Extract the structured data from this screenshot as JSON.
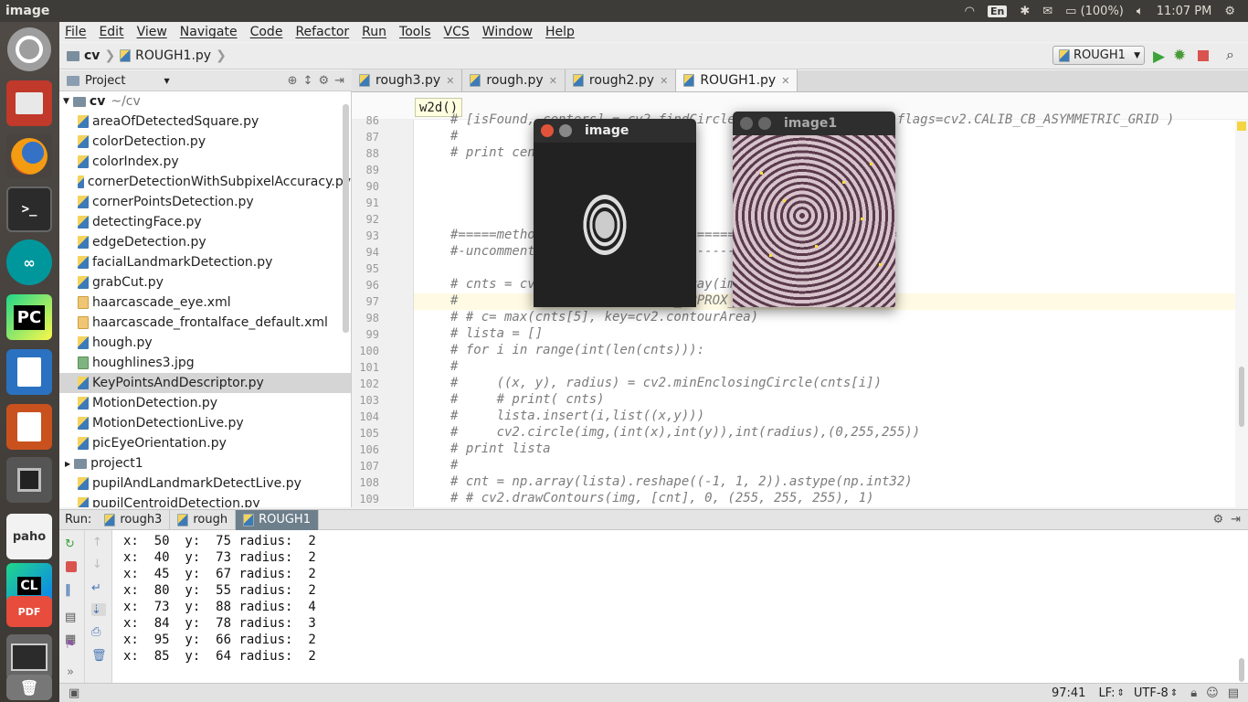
{
  "system": {
    "app_title": "image",
    "keyboard": "En",
    "battery": "(100%)",
    "clock": "11:07 PM"
  },
  "menu": [
    "File",
    "Edit",
    "View",
    "Navigate",
    "Code",
    "Refactor",
    "Run",
    "Tools",
    "VCS",
    "Window",
    "Help"
  ],
  "nav": {
    "project": "cv",
    "file": "ROUGH1.py",
    "run_config": "ROUGH1"
  },
  "project_panel": {
    "title": "Project",
    "root_name": "cv",
    "root_path": "~/cv",
    "files": [
      {
        "name": "areaOfDetectedSquare.py",
        "type": "py"
      },
      {
        "name": "colorDetection.py",
        "type": "py"
      },
      {
        "name": "colorIndex.py",
        "type": "py"
      },
      {
        "name": "cornerDetectionWithSubpixelAccuracy.py",
        "type": "py"
      },
      {
        "name": "cornerPointsDetection.py",
        "type": "py"
      },
      {
        "name": "detectingFace.py",
        "type": "py"
      },
      {
        "name": "edgeDetection.py",
        "type": "py"
      },
      {
        "name": "facialLandmarkDetection.py",
        "type": "py"
      },
      {
        "name": "grabCut.py",
        "type": "py"
      },
      {
        "name": "haarcascade_eye.xml",
        "type": "xml"
      },
      {
        "name": "haarcascade_frontalface_default.xml",
        "type": "xml"
      },
      {
        "name": "hough.py",
        "type": "py"
      },
      {
        "name": "houghlines3.jpg",
        "type": "jpg"
      },
      {
        "name": "KeyPointsAndDescriptor.py",
        "type": "py",
        "selected": true
      },
      {
        "name": "MotionDetection.py",
        "type": "py"
      },
      {
        "name": "MotionDetectionLive.py",
        "type": "py"
      },
      {
        "name": "picEyeOrientation.py",
        "type": "py"
      },
      {
        "name": "project1",
        "type": "folder"
      },
      {
        "name": "pupilAndLandmarkDetectLive.py",
        "type": "py"
      },
      {
        "name": "pupilCentroidDetection.py",
        "type": "py"
      }
    ]
  },
  "tabs": [
    {
      "label": "rough3.py",
      "active": false
    },
    {
      "label": "rough.py",
      "active": false
    },
    {
      "label": "rough2.py",
      "active": false
    },
    {
      "label": "ROUGH1.py",
      "active": true
    }
  ],
  "editor": {
    "breadcrumb": "w2d()",
    "lines": [
      {
        "n": "86",
        "t": "# [isFound, centers] = cv2.findCirclesGrid(image, (4,11), flags=cv2.CALIB_CB_ASYMMETRIC_GRID )"
      },
      {
        "n": "87",
        "t": "#"
      },
      {
        "n": "88",
        "t": "# print centers"
      },
      {
        "n": "89",
        "t": ""
      },
      {
        "n": "90",
        "t": ""
      },
      {
        "n": "91",
        "t": ""
      },
      {
        "n": "92",
        "t": ""
      },
      {
        "n": "93",
        "t": "#=====method 2 ==========================================="
      },
      {
        "n": "94",
        "t": "#-uncomment the below code ---------------"
      },
      {
        "n": "95",
        "t": ""
      },
      {
        "n": "96",
        "t": "# cnts = cv2.findContours(np.array(img), cv2.RETR_CCOMP,"
      },
      {
        "n": "97",
        "t": "#                   cv2.CHAIN_APPROX_NONE)[-2]"
      },
      {
        "n": "98",
        "t": "# # c= max(cnts[5], key=cv2.contourArea)"
      },
      {
        "n": "99",
        "t": "# lista = []"
      },
      {
        "n": "100",
        "t": "# for i in range(int(len(cnts))):"
      },
      {
        "n": "101",
        "t": "#"
      },
      {
        "n": "102",
        "t": "#     ((x, y), radius) = cv2.minEnclosingCircle(cnts[i])"
      },
      {
        "n": "103",
        "t": "#     # print( cnts)"
      },
      {
        "n": "104",
        "t": "#     lista.insert(i,list((x,y)))"
      },
      {
        "n": "105",
        "t": "#     cv2.circle(img,(int(x),int(y)),int(radius),(0,255,255))"
      },
      {
        "n": "106",
        "t": "# print lista"
      },
      {
        "n": "107",
        "t": "#"
      },
      {
        "n": "108",
        "t": "# cnt = np.array(lista).reshape((-1, 1, 2)).astype(np.int32)"
      },
      {
        "n": "109",
        "t": "# # cv2.drawContours(img, [cnt], 0, (255, 255, 255), 1)"
      }
    ],
    "current_line_index": 11
  },
  "windows": {
    "image": {
      "title": "image"
    },
    "image1": {
      "title": "image1"
    }
  },
  "run": {
    "label": "Run:",
    "tabs": [
      {
        "label": "rough3",
        "active": false
      },
      {
        "label": "rough",
        "active": false
      },
      {
        "label": "ROUGH1",
        "active": true
      }
    ],
    "output": [
      {
        "x": "50",
        "y": "75",
        "r": "2"
      },
      {
        "x": "40",
        "y": "73",
        "r": "2"
      },
      {
        "x": "45",
        "y": "67",
        "r": "2"
      },
      {
        "x": "80",
        "y": "55",
        "r": "2"
      },
      {
        "x": "73",
        "y": "88",
        "r": "4"
      },
      {
        "x": "84",
        "y": "78",
        "r": "3"
      },
      {
        "x": "95",
        "y": "66",
        "r": "2"
      },
      {
        "x": "85",
        "y": "64",
        "r": "2"
      }
    ]
  },
  "status": {
    "position": "97:41",
    "line_sep": "LF:",
    "encoding": "UTF-8"
  },
  "launcher": [
    "ubuntu-icon",
    "files-icon",
    "firefox-icon",
    "terminal-icon",
    "arduino-icon",
    "pycharm-icon",
    "writer-icon",
    "impress-icon",
    "chip-icon",
    "paho-icon",
    "clion-icon",
    "pdf-icon",
    "monitor-icon",
    "trash-icon"
  ]
}
